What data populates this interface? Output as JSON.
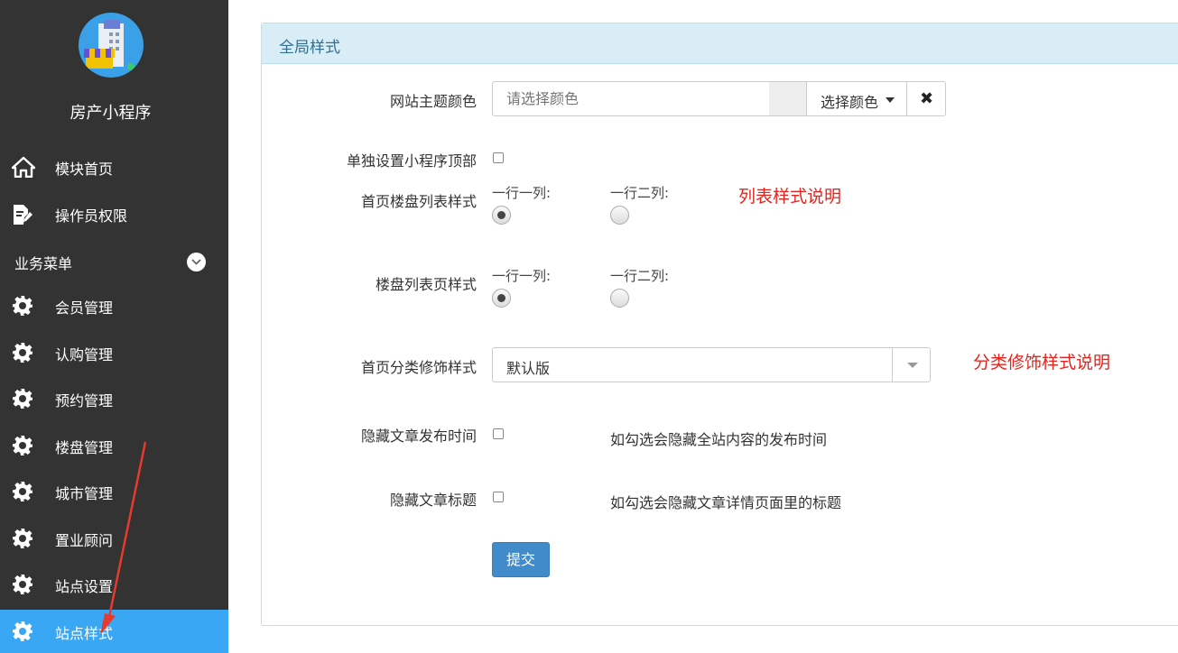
{
  "sidebar": {
    "app_name": "房产小程序",
    "items": [
      {
        "label": "模块首页",
        "icon": "home-icon"
      },
      {
        "label": "操作员权限",
        "icon": "edit-document-icon"
      }
    ],
    "section": {
      "title": "业务菜单",
      "icon": "chevron-down-icon"
    },
    "menu": [
      {
        "label": "会员管理",
        "icon": "gear-icon"
      },
      {
        "label": "认购管理",
        "icon": "gear-icon"
      },
      {
        "label": "预约管理",
        "icon": "gear-icon"
      },
      {
        "label": "楼盘管理",
        "icon": "gear-icon"
      },
      {
        "label": "城市管理",
        "icon": "gear-icon"
      },
      {
        "label": "置业顾问",
        "icon": "gear-icon"
      },
      {
        "label": "站点设置",
        "icon": "gear-icon"
      },
      {
        "label": "站点样式",
        "icon": "gear-icon",
        "active": true
      }
    ],
    "colors": {
      "background": "#333333",
      "active": "#3aa7f5"
    }
  },
  "panel": {
    "title": "全局样式",
    "theme_color": {
      "label": "网站主题颜色",
      "placeholder": "请选择颜色",
      "value": "",
      "pick_button": "选择颜色",
      "clear_icon": "close-icon"
    },
    "mini_top": {
      "label": "单独设置小程序顶部",
      "checked": false
    },
    "home_list_style": {
      "label": "首页楼盘列表样式",
      "options": [
        "一行一列:",
        "一行二列:"
      ],
      "selected": 0,
      "note": "列表样式说明"
    },
    "list_page_style": {
      "label": "楼盘列表页样式",
      "options": [
        "一行一列:",
        "一行二列:"
      ],
      "selected": 0
    },
    "category_style": {
      "label": "首页分类修饰样式",
      "value": "默认版",
      "note": "分类修饰样式说明"
    },
    "hide_publish_time": {
      "label": "隐藏文章发布时间",
      "checked": false,
      "hint": "如勾选会隐藏全站内容的发布时间"
    },
    "hide_article_title": {
      "label": "隐藏文章标题",
      "checked": false,
      "hint": "如勾选会隐藏文章详情页面里的标题"
    },
    "submit_label": "提交",
    "colors": {
      "header_bg": "#d9edf7",
      "header_text": "#31708f",
      "note": "#e3251f",
      "primary": "#428bca"
    }
  }
}
